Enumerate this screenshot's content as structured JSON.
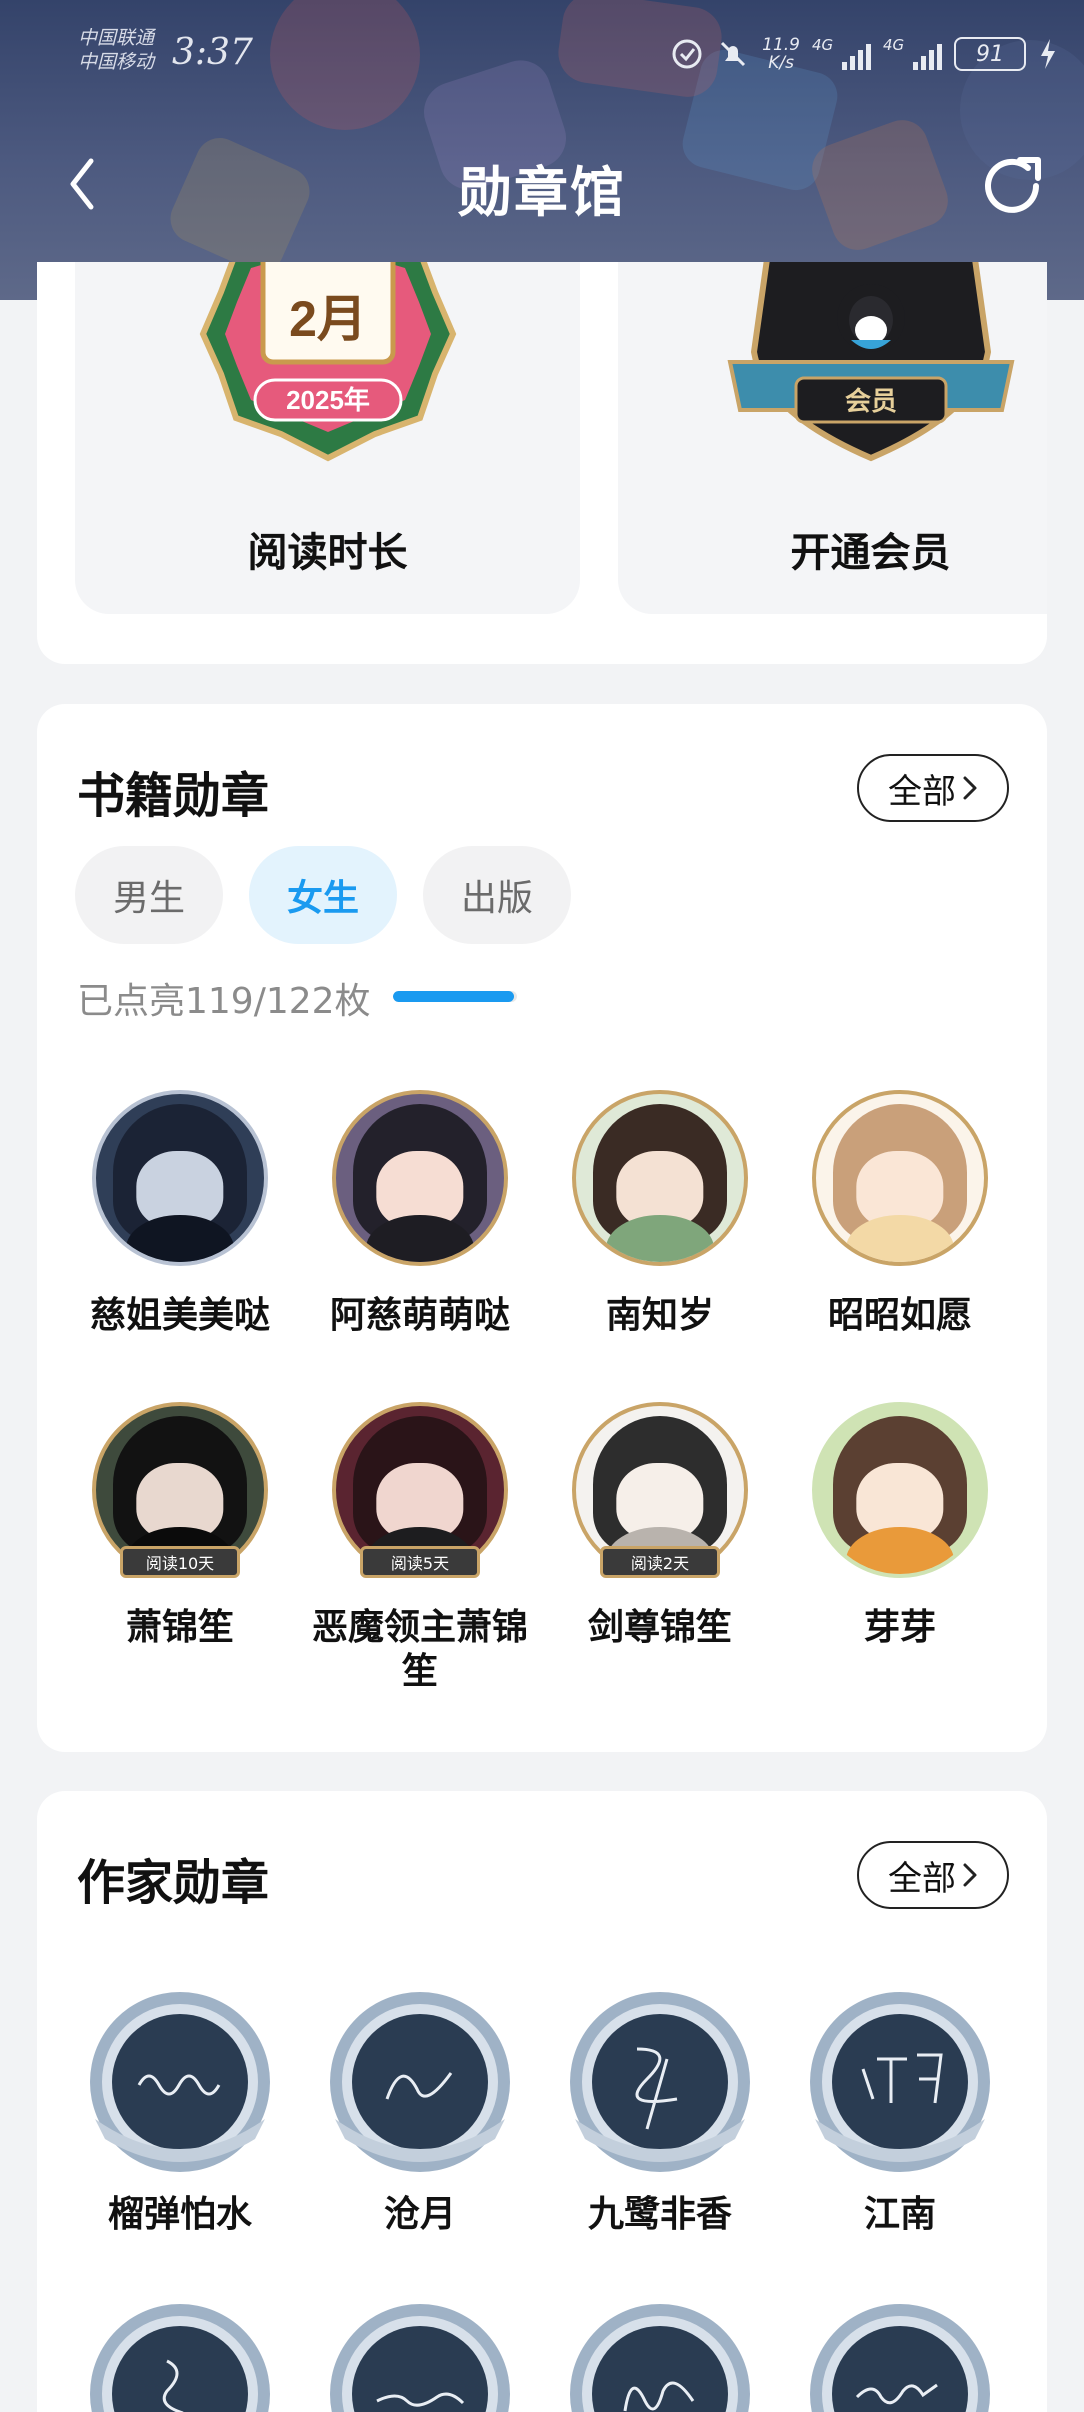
{
  "status_bar": {
    "carrier_1": "中国联通",
    "carrier_2": "中国移动",
    "time": "3:37",
    "net_speed_value": "11.9",
    "net_speed_unit": "K/s",
    "signal_1_label": "4G",
    "signal_2_label": "4G",
    "battery": "91",
    "icons": [
      "vpn-icon",
      "mute-icon",
      "signal-icon",
      "battery-icon",
      "charging-icon"
    ]
  },
  "header": {
    "title": "勋章馆",
    "back_icon": "chevron-left-icon",
    "refresh_icon": "refresh-icon"
  },
  "top_badges": {
    "items": [
      {
        "label": "阅读时长",
        "badge_text_1": "2月",
        "badge_text_2": "2025年"
      },
      {
        "label": "开通会员",
        "badge_text_1": "会员"
      }
    ]
  },
  "books_section": {
    "title": "书籍勋章",
    "all_label": "全部",
    "tabs": [
      {
        "label": "男生",
        "active": false
      },
      {
        "label": "女生",
        "active": true
      },
      {
        "label": "出版",
        "active": false
      }
    ],
    "progress_text": "已点亮119/122枚",
    "progress_fraction": 0.975,
    "badges": [
      {
        "name": "慈姐美美哒",
        "ribbon": ""
      },
      {
        "name": "阿慈萌萌哒",
        "ribbon": ""
      },
      {
        "name": "南知岁",
        "ribbon": ""
      },
      {
        "name": "昭昭如愿",
        "ribbon": ""
      },
      {
        "name": "萧锦笙",
        "ribbon": "阅读10天"
      },
      {
        "name": "恶魔领主萧锦笙",
        "ribbon": "阅读5天"
      },
      {
        "name": "剑尊锦笙",
        "ribbon": "阅读2天"
      },
      {
        "name": "芽芽",
        "ribbon": ""
      }
    ]
  },
  "authors_section": {
    "title": "作家勋章",
    "all_label": "全部",
    "badges": [
      {
        "name": "榴弹怕水"
      },
      {
        "name": "沧月"
      },
      {
        "name": "九鹭非香"
      },
      {
        "name": "江南"
      }
    ]
  },
  "colors": {
    "accent": "#1a9af0",
    "header_bg": "#3e4c74",
    "gold": "#c9a467"
  }
}
